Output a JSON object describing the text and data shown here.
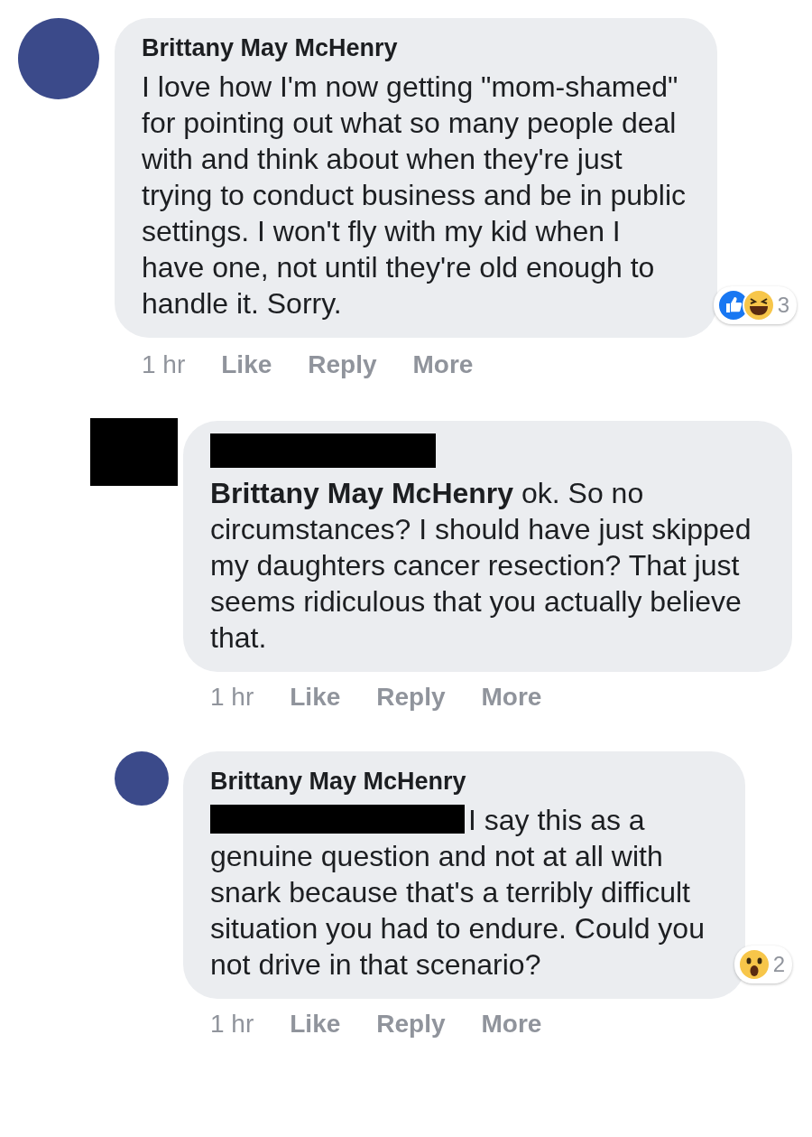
{
  "comments": [
    {
      "author": "Brittany May McHenry",
      "author_redacted": false,
      "avatar": {
        "kind": "photo"
      },
      "mention_redacted": false,
      "text": "I love how I'm now getting \"mom-shamed\" for pointing out what so many people deal with and think about when they're just trying to conduct business and be in public settings. I won't fly with my kid when I have one, not until they're old enough to handle it. Sorry.",
      "reactions": {
        "kinds": [
          {
            "kind": "like"
          },
          {
            "kind": "haha"
          }
        ],
        "count": "3"
      },
      "time": "1 hr",
      "actions": [
        "Like",
        "Reply",
        "More"
      ],
      "replies": [
        {
          "author_redacted": true,
          "avatar": {
            "kind": "redacted"
          },
          "mention_redacted": false,
          "text": "**Brittany May McHenry** ok. So no circumstances? I should have just skipped my daughters cancer resection? That just seems ridiculous that you actually believe that.",
          "time": "1 hr",
          "actions": [
            "Like",
            "Reply",
            "More"
          ]
        },
        {
          "author": "Brittany May McHenry",
          "author_redacted": false,
          "avatar": {
            "kind": "photo"
          },
          "mention_redacted": true,
          "text": "I say this as a genuine question and not at all with snark because that's a terribly difficult situation you had to endure. Could you not drive in that scenario?",
          "reactions": {
            "kinds": [
              {
                "kind": "wow"
              }
            ],
            "count": "2"
          },
          "time": "1 hr",
          "actions": [
            "Like",
            "Reply",
            "More"
          ]
        }
      ]
    }
  ]
}
